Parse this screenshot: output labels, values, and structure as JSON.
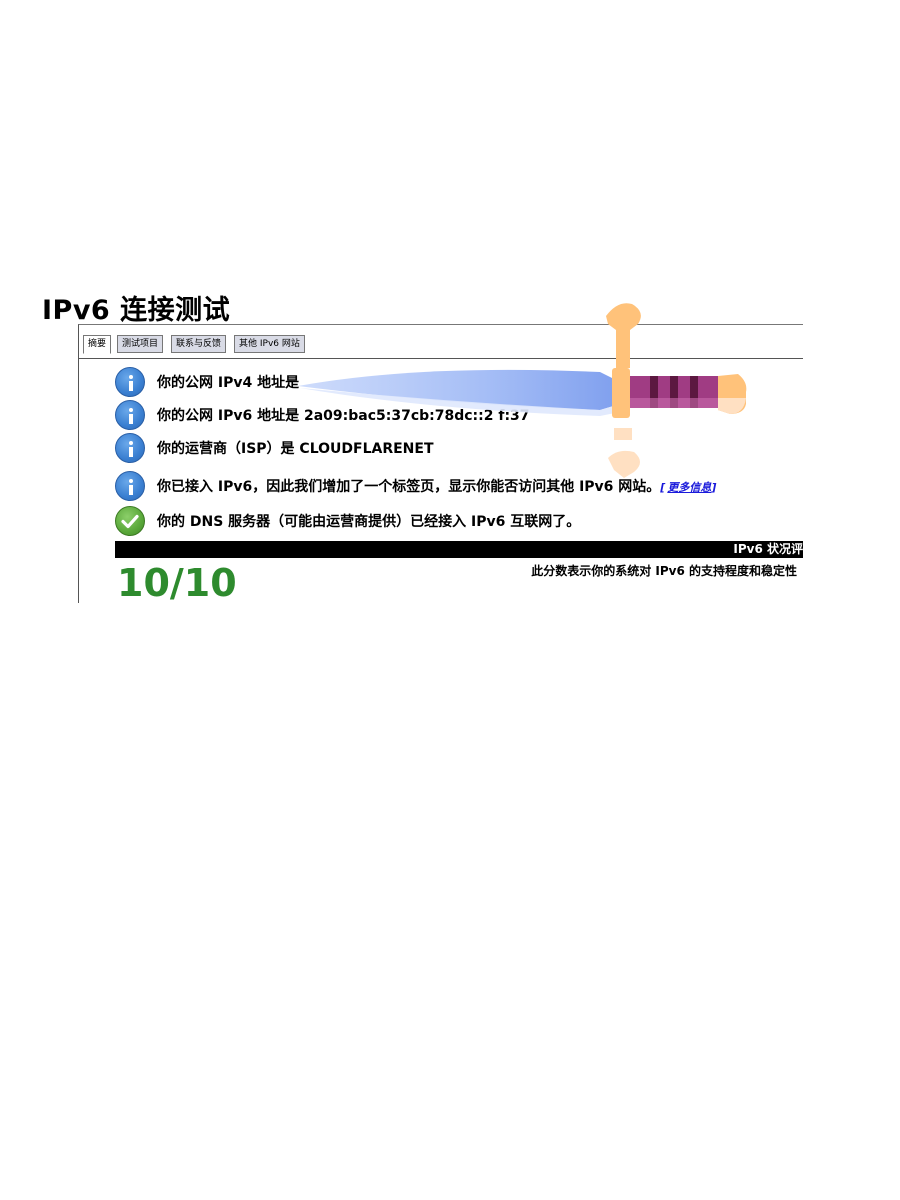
{
  "page": {
    "title": "IPv6 连接测试"
  },
  "tabs": [
    {
      "label": "摘要"
    },
    {
      "label": "测试项目"
    },
    {
      "label": "联系与反馈"
    },
    {
      "label": "其他 IPv6 网站"
    }
  ],
  "results": [
    {
      "icon": "info-icon",
      "text": "你的公网 IPv4 地址是"
    },
    {
      "icon": "info-icon",
      "text": "你的公网 IPv6 地址是 2a09:bac5:37cb:78dc::2 f:37"
    },
    {
      "icon": "info-icon",
      "text": "你的运营商（ISP）是 CLOUDFLARENET"
    },
    {
      "icon": "info-icon",
      "text": "你已接入 IPv6，因此我们增加了一个标签页，显示你能否访问其他 IPv6 网站。",
      "link": "更多信息"
    },
    {
      "icon": "check-icon",
      "text": "你的 DNS 服务器（可能由运营商提供）已经接入 IPv6 互联网了。"
    }
  ],
  "score": {
    "header": "IPv6 状况评",
    "value": "10/10",
    "description": "此分数表示你的系统对 IPv6 的支持程度和稳定性"
  },
  "colors": {
    "score_green": "#2e8b2e",
    "link_blue": "#1a1adb",
    "info_blue": "#3a7fd1",
    "ok_green": "#5aa83a"
  },
  "overlay": {
    "icon": "sword-icon"
  }
}
